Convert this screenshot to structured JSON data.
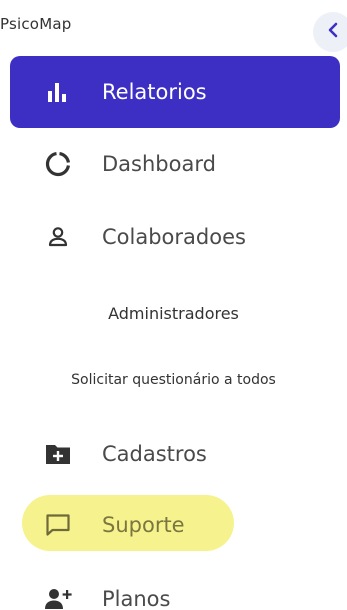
{
  "brand": {
    "name": "PsicoMap"
  },
  "collapse": {
    "icon": "chevron-left-icon"
  },
  "colors": {
    "active_bg": "#3d2fc4",
    "highlight": "#f5f288",
    "text": "#4a4a4a",
    "icon": "#333333"
  },
  "nav": {
    "relatorios": {
      "label": "Relatorios",
      "icon": "bar-chart-icon",
      "active": true
    },
    "dashboard": {
      "label": "Dashboard",
      "icon": "donut-icon"
    },
    "colaboradores": {
      "label": "Colaboradoes",
      "icon": "user-icon"
    },
    "administradores": {
      "label": "Administradores"
    },
    "solicitar": {
      "label": "Solicitar questionário a todos"
    },
    "cadastros": {
      "label": "Cadastros",
      "icon": "folder-plus-icon"
    },
    "suporte": {
      "label": "Suporte",
      "icon": "chat-icon",
      "highlighted": true
    },
    "planos": {
      "label": "Planos",
      "icon": "user-add-icon"
    }
  }
}
